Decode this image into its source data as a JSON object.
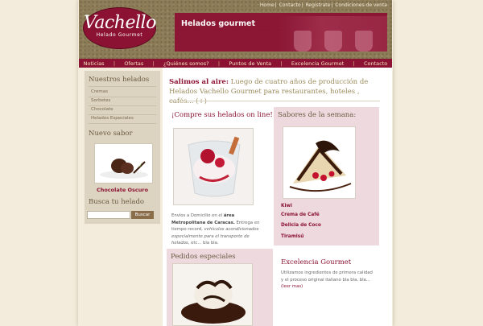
{
  "top_links": [
    "Home",
    "Contacto",
    "Registrate",
    "Condiciones de venta"
  ],
  "logo": {
    "name": "Vachello",
    "tagline": "Helado Gourmet"
  },
  "hero": {
    "title": "Helados gourmet"
  },
  "nav": [
    "Noticias",
    "Ofertas",
    "¿Quiénes somos?",
    "Puntos de Venta",
    "Excelencia Gourmet",
    "Contacto"
  ],
  "sidebar": {
    "section_title": "Nuestros helados",
    "items": [
      "Cremas",
      "Sorbetes",
      "Chocolate",
      "Helados Especiales"
    ],
    "flavor_title": "Nuevo sabor",
    "flavor_name": "Chocolate Oscuro",
    "search_title": "Busca tu helado",
    "search_button": "Buscar"
  },
  "intro": {
    "lead": "Salimos al aire:",
    "text": " Luego de cuatro años de producción de Helados Vachello Gourmet para restaurantes, hoteles , cafés... (+)"
  },
  "online": {
    "title": "¡Compre sus helados on line!",
    "text_1": "Envíos a Domicilio en el ",
    "text_bold": "área Metropolitana de Caracas.",
    "text_2": " Entrega en tiempo record, ",
    "text_italic": "vehículos acondicionados especialmente para el transporte de helados",
    "text_3": ", etc... bla bla."
  },
  "flavors": {
    "title": "Sabores de la semana:",
    "items": [
      "Kiwi",
      "Crema de Café",
      "Delicia de Coco",
      "Tiramisú"
    ]
  },
  "special": {
    "title": "Pedidos especiales"
  },
  "excellence": {
    "title": "Excelencia Gourmet",
    "text": "Utilizamos ingredientes de primera calidad y el proceso original italiano bla bla, bla...",
    "more": "(leer mas)"
  },
  "colors": {
    "brand": "#8b1233",
    "pink_panel": "#eed9de",
    "sidebar": "#dcd4c1",
    "header": "#8d7c58"
  }
}
